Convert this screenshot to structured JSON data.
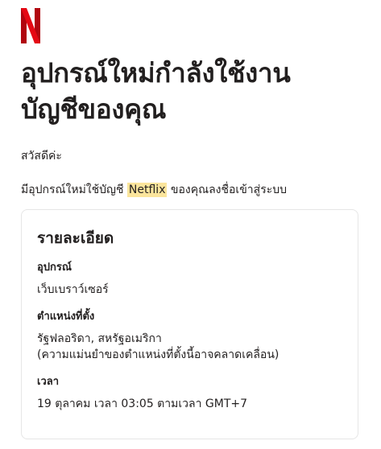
{
  "email": {
    "logo_icon": "netflix-n-logo",
    "brand_color": "#e50914",
    "headline_line1": "อุปกรณ์ใหม่กำลังใช้งาน",
    "headline_line2": "บัญชีของคุณ",
    "greeting": "สวัสดีค่ะ",
    "message_before": "มีอุปกรณ์ใหม่ใช้บัญชี ",
    "message_brand": "Netflix",
    "message_after": " ของคุณลงชื่อเข้าสู่ระบบ",
    "details": {
      "title": "รายละเอียด",
      "device_label": "อุปกรณ์",
      "device_value": "เว็บเบราว์เซอร์",
      "location_label": "ตำแหน่งที่ตั้ง",
      "location_value": "รัฐฟลอริดา, สหรัฐอเมริกา",
      "location_note": "(ความแม่นยำของตำแหน่งที่ตั้งนี้อาจคลาดเคลื่อน)",
      "time_label": "เวลา",
      "time_value": "19 ตุลาคม เวลา 03:05 ตามเวลา GMT+7"
    }
  }
}
